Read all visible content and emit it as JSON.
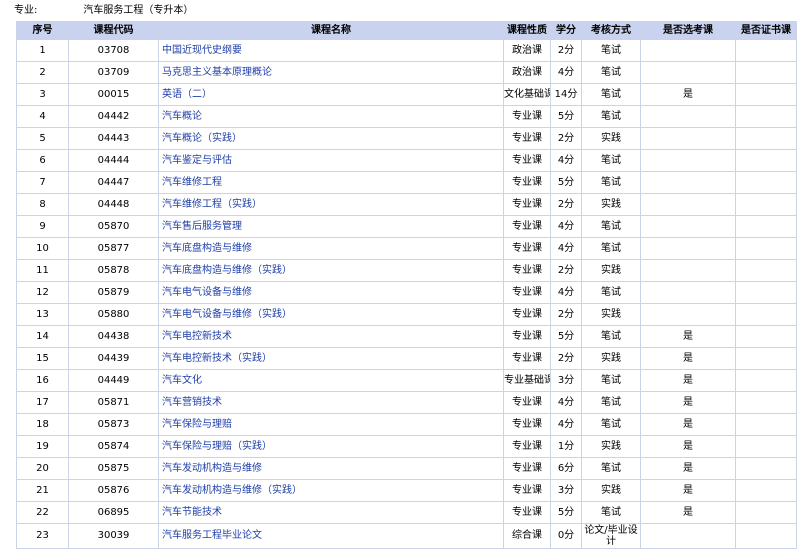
{
  "header": {
    "major_label": "专业:",
    "major_name": "汽车服务工程（专升本）"
  },
  "columns": [
    "序号",
    "课程代码",
    "课程名称",
    "课程性质",
    "学分",
    "考核方式",
    "是否选考课",
    "是否证书课"
  ],
  "rows": [
    {
      "no": "1",
      "code": "03708",
      "name": "中国近现代史纲要",
      "type": "政治课",
      "credit": "2分",
      "method": "笔试",
      "elective": "",
      "cert": ""
    },
    {
      "no": "2",
      "code": "03709",
      "name": "马克思主义基本原理概论",
      "type": "政治课",
      "credit": "4分",
      "method": "笔试",
      "elective": "",
      "cert": ""
    },
    {
      "no": "3",
      "code": "00015",
      "name": "英语（二）",
      "type": "文化基础课",
      "credit": "14分",
      "method": "笔试",
      "elective": "是",
      "cert": ""
    },
    {
      "no": "4",
      "code": "04442",
      "name": "汽车概论",
      "type": "专业课",
      "credit": "5分",
      "method": "笔试",
      "elective": "",
      "cert": ""
    },
    {
      "no": "5",
      "code": "04443",
      "name": "汽车概论（实践）",
      "type": "专业课",
      "credit": "2分",
      "method": "实践",
      "elective": "",
      "cert": ""
    },
    {
      "no": "6",
      "code": "04444",
      "name": "汽车鉴定与评估",
      "type": "专业课",
      "credit": "4分",
      "method": "笔试",
      "elective": "",
      "cert": ""
    },
    {
      "no": "7",
      "code": "04447",
      "name": "汽车维修工程",
      "type": "专业课",
      "credit": "5分",
      "method": "笔试",
      "elective": "",
      "cert": ""
    },
    {
      "no": "8",
      "code": "04448",
      "name": "汽车维修工程（实践）",
      "type": "专业课",
      "credit": "2分",
      "method": "实践",
      "elective": "",
      "cert": ""
    },
    {
      "no": "9",
      "code": "05870",
      "name": "汽车售后服务管理",
      "type": "专业课",
      "credit": "4分",
      "method": "笔试",
      "elective": "",
      "cert": ""
    },
    {
      "no": "10",
      "code": "05877",
      "name": "汽车底盘构造与维修",
      "type": "专业课",
      "credit": "4分",
      "method": "笔试",
      "elective": "",
      "cert": ""
    },
    {
      "no": "11",
      "code": "05878",
      "name": "汽车底盘构造与维修（实践）",
      "type": "专业课",
      "credit": "2分",
      "method": "实践",
      "elective": "",
      "cert": ""
    },
    {
      "no": "12",
      "code": "05879",
      "name": "汽车电气设备与维修",
      "type": "专业课",
      "credit": "4分",
      "method": "笔试",
      "elective": "",
      "cert": ""
    },
    {
      "no": "13",
      "code": "05880",
      "name": "汽车电气设备与维修（实践）",
      "type": "专业课",
      "credit": "2分",
      "method": "实践",
      "elective": "",
      "cert": ""
    },
    {
      "no": "14",
      "code": "04438",
      "name": "汽车电控新技术",
      "type": "专业课",
      "credit": "5分",
      "method": "笔试",
      "elective": "是",
      "cert": ""
    },
    {
      "no": "15",
      "code": "04439",
      "name": "汽车电控新技术（实践）",
      "type": "专业课",
      "credit": "2分",
      "method": "实践",
      "elective": "是",
      "cert": ""
    },
    {
      "no": "16",
      "code": "04449",
      "name": "汽车文化",
      "type": "专业基础课",
      "credit": "3分",
      "method": "笔试",
      "elective": "是",
      "cert": ""
    },
    {
      "no": "17",
      "code": "05871",
      "name": "汽车营销技术",
      "type": "专业课",
      "credit": "4分",
      "method": "笔试",
      "elective": "是",
      "cert": ""
    },
    {
      "no": "18",
      "code": "05873",
      "name": "汽车保险与理赔",
      "type": "专业课",
      "credit": "4分",
      "method": "笔试",
      "elective": "是",
      "cert": ""
    },
    {
      "no": "19",
      "code": "05874",
      "name": "汽车保险与理赔（实践）",
      "type": "专业课",
      "credit": "1分",
      "method": "实践",
      "elective": "是",
      "cert": ""
    },
    {
      "no": "20",
      "code": "05875",
      "name": "汽车发动机构造与维修",
      "type": "专业课",
      "credit": "6分",
      "method": "笔试",
      "elective": "是",
      "cert": ""
    },
    {
      "no": "21",
      "code": "05876",
      "name": "汽车发动机构造与维修（实践）",
      "type": "专业课",
      "credit": "3分",
      "method": "实践",
      "elective": "是",
      "cert": ""
    },
    {
      "no": "22",
      "code": "06895",
      "name": "汽车节能技术",
      "type": "专业课",
      "credit": "5分",
      "method": "笔试",
      "elective": "是",
      "cert": ""
    },
    {
      "no": "23",
      "code": "30039",
      "name": "汽车服务工程毕业论文",
      "type": "综合课",
      "credit": "0分",
      "method": "论文/毕业设计",
      "elective": "",
      "cert": ""
    }
  ]
}
